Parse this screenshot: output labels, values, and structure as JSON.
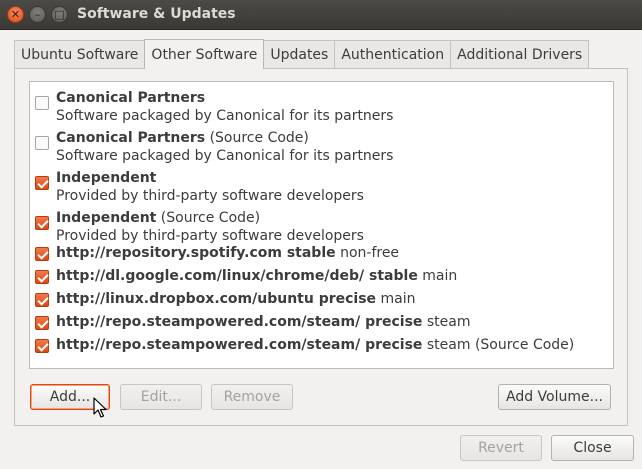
{
  "window": {
    "title": "Software & Updates"
  },
  "tabs": [
    {
      "label": "Ubuntu Software",
      "active": false
    },
    {
      "label": "Other Software",
      "active": true
    },
    {
      "label": "Updates",
      "active": false
    },
    {
      "label": "Authentication",
      "active": false
    },
    {
      "label": "Additional Drivers",
      "active": false
    }
  ],
  "sources": [
    {
      "bold": "Canonical Partners",
      "suffix": "",
      "subtitle": "Software packaged by Canonical for its partners",
      "checked": false
    },
    {
      "bold": "Canonical Partners",
      "suffix": " (Source Code)",
      "subtitle": "Software packaged by Canonical for its partners",
      "checked": false
    },
    {
      "bold": "Independent",
      "suffix": "",
      "subtitle": "Provided by third-party software developers",
      "checked": true
    },
    {
      "bold": "Independent",
      "suffix": " (Source Code)",
      "subtitle": "Provided by third-party software developers",
      "checked": true
    },
    {
      "bold": "http://repository.spotify.com stable",
      "suffix": " non-free",
      "subtitle": "",
      "checked": true
    },
    {
      "bold": "http://dl.google.com/linux/chrome/deb/ stable",
      "suffix": " main",
      "subtitle": "",
      "checked": true
    },
    {
      "bold": "http://linux.dropbox.com/ubuntu precise",
      "suffix": " main",
      "subtitle": "",
      "checked": true
    },
    {
      "bold": "http://repo.steampowered.com/steam/ precise",
      "suffix": " steam",
      "subtitle": "",
      "checked": true
    },
    {
      "bold": "http://repo.steampowered.com/steam/ precise",
      "suffix": " steam (Source Code)",
      "subtitle": "",
      "checked": true
    }
  ],
  "buttons": {
    "add": "Add...",
    "edit": "Edit...",
    "remove": "Remove",
    "add_volume": "Add Volume...",
    "revert": "Revert",
    "close": "Close"
  },
  "colors": {
    "accent": "#dd4814",
    "titlebar": "#3c3b37"
  }
}
